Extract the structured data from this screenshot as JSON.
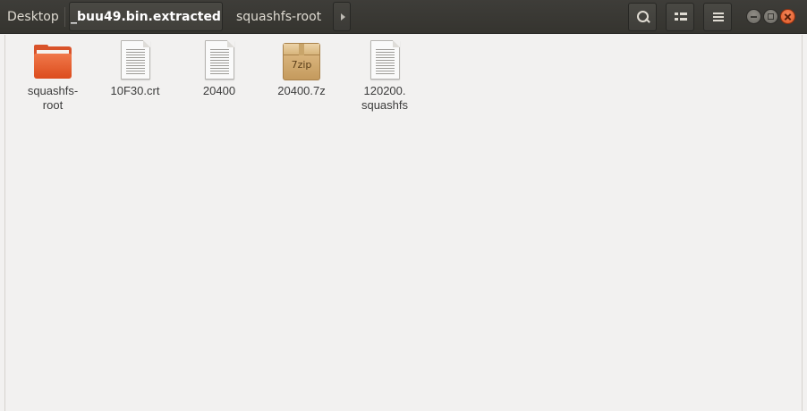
{
  "breadcrumb": {
    "items": [
      "Desktop",
      "_buu49.bin.extracted",
      "squashfs-root"
    ],
    "active_index": 1
  },
  "toolbar": {
    "search_icon": "search-icon",
    "view_icon": "list-view-icon",
    "menu_icon": "hamburger-menu-icon"
  },
  "files": [
    {
      "name": "squashfs-\nroot",
      "type": "folder"
    },
    {
      "name": "10F30.crt",
      "type": "document"
    },
    {
      "name": "20400",
      "type": "document"
    },
    {
      "name": "20400.7z",
      "type": "archive",
      "badge": "7zip"
    },
    {
      "name": "120200.\nsquashfs",
      "type": "document"
    }
  ],
  "colors": {
    "header_bg": "#3e3d39",
    "content_bg": "#f2f1f0",
    "folder": "#dc4c1d",
    "close_button": "#e05a27"
  }
}
